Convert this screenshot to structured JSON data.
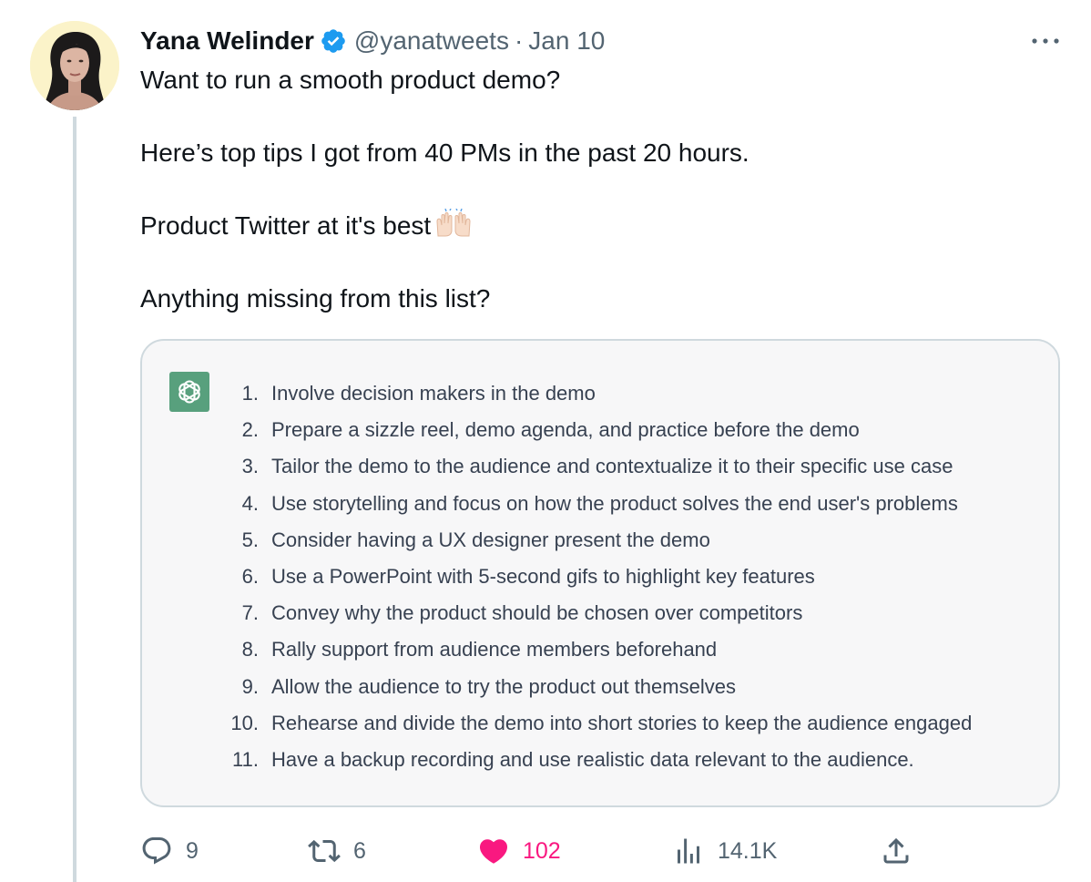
{
  "tweet": {
    "author_name": "Yana Welinder",
    "handle": "@yanatweets",
    "separator": "·",
    "date": "Jan 10",
    "paragraphs": [
      "Want to run a smooth product demo?",
      "Here’s top tips I got from 40 PMs in the past 20 hours.",
      "Product Twitter at it's best",
      "Anything missing from this list?"
    ],
    "emoji": "raising-hands-emoji"
  },
  "media": {
    "logo": "chatgpt-logo-icon",
    "list": [
      {
        "num": "1.",
        "text": "Involve decision makers in the demo"
      },
      {
        "num": "2.",
        "text": "Prepare a sizzle reel, demo agenda, and practice before the demo"
      },
      {
        "num": "3.",
        "text": "Tailor the demo to the audience and contextualize it to their specific use case"
      },
      {
        "num": "4.",
        "text": "Use storytelling and focus on how the product solves the end user's problems"
      },
      {
        "num": "5.",
        "text": "Consider having a UX designer present the demo"
      },
      {
        "num": "6.",
        "text": "Use a PowerPoint with 5-second gifs to highlight key features"
      },
      {
        "num": "7.",
        "text": "Convey why the product should be chosen over competitors"
      },
      {
        "num": "8.",
        "text": "Rally support from audience members beforehand"
      },
      {
        "num": "9.",
        "text": "Allow the audience to try the product out themselves"
      },
      {
        "num": "10.",
        "text": "Rehearse and divide the demo into short stories to keep the audience engaged"
      },
      {
        "num": "11.",
        "text": "Have a backup recording and use realistic data relevant to the audience."
      }
    ]
  },
  "actions": {
    "replies": "9",
    "retweets": "6",
    "likes": "102",
    "views": "14.1K"
  },
  "colors": {
    "verified": "#1d9bf0",
    "like": "#f91880",
    "secondary_text": "#536471",
    "chatgpt_green": "#58a07d"
  }
}
